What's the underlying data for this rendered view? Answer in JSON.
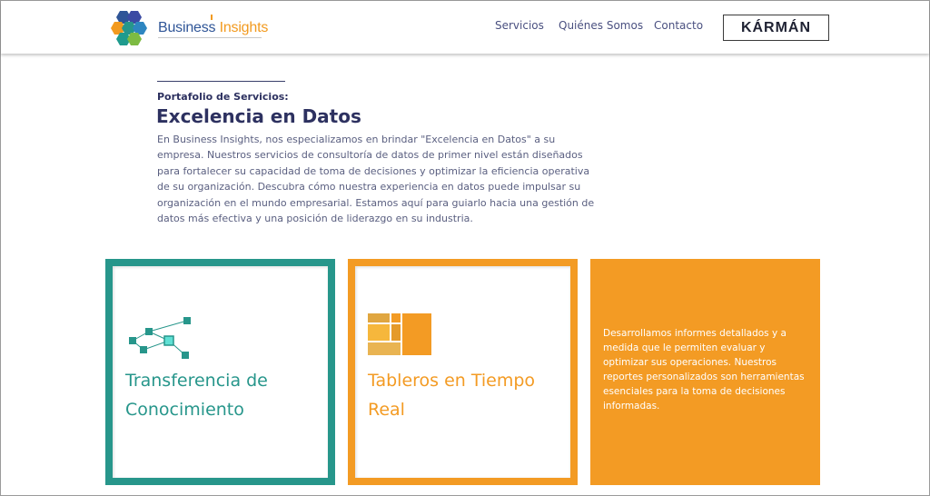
{
  "header": {
    "logo_word1": "Business",
    "logo_word2": "Insights",
    "nav": [
      "Servicios",
      "Quiénes Somos",
      "Contacto"
    ],
    "partner_logo": "KÁRMÁN"
  },
  "intro": {
    "kicker": "Portafolio de Servicios:",
    "heading": "Excelencia en Datos",
    "body": "En Business Insights, nos especializamos en brindar \"Excelencia en Datos\" a su empresa. Nuestros servicios de consultoría de datos de primer nivel están diseñados para fortalecer su capacidad de toma de decisiones y optimizar la eficiencia operativa de su organización. Descubra cómo nuestra experiencia en datos puede impulsar su organización en el mundo empresarial. Estamos aquí para guiarlo hacia una gestión de datos más efectiva y una posición de liderazgo en su industria."
  },
  "cards": [
    {
      "title": "Transferencia de Conocimiento",
      "icon": "network-nodes-icon",
      "accent": "#27968b"
    },
    {
      "title": "Tableros en Tiempo Real",
      "icon": "dashboard-tiles-icon",
      "accent": "#f39b24"
    },
    {
      "description": "Desarrollamos informes detallados y a medida que le permiten evaluar y optimizar sus operaciones. Nuestros reportes personalizados son herramientas esenciales para la toma de decisiones informadas.",
      "accent": "#f39b24"
    }
  ],
  "colors": {
    "brand_blue": "#2f5597",
    "brand_orange": "#f29a1f",
    "teal": "#27968b",
    "text_dark": "#2d3160"
  }
}
